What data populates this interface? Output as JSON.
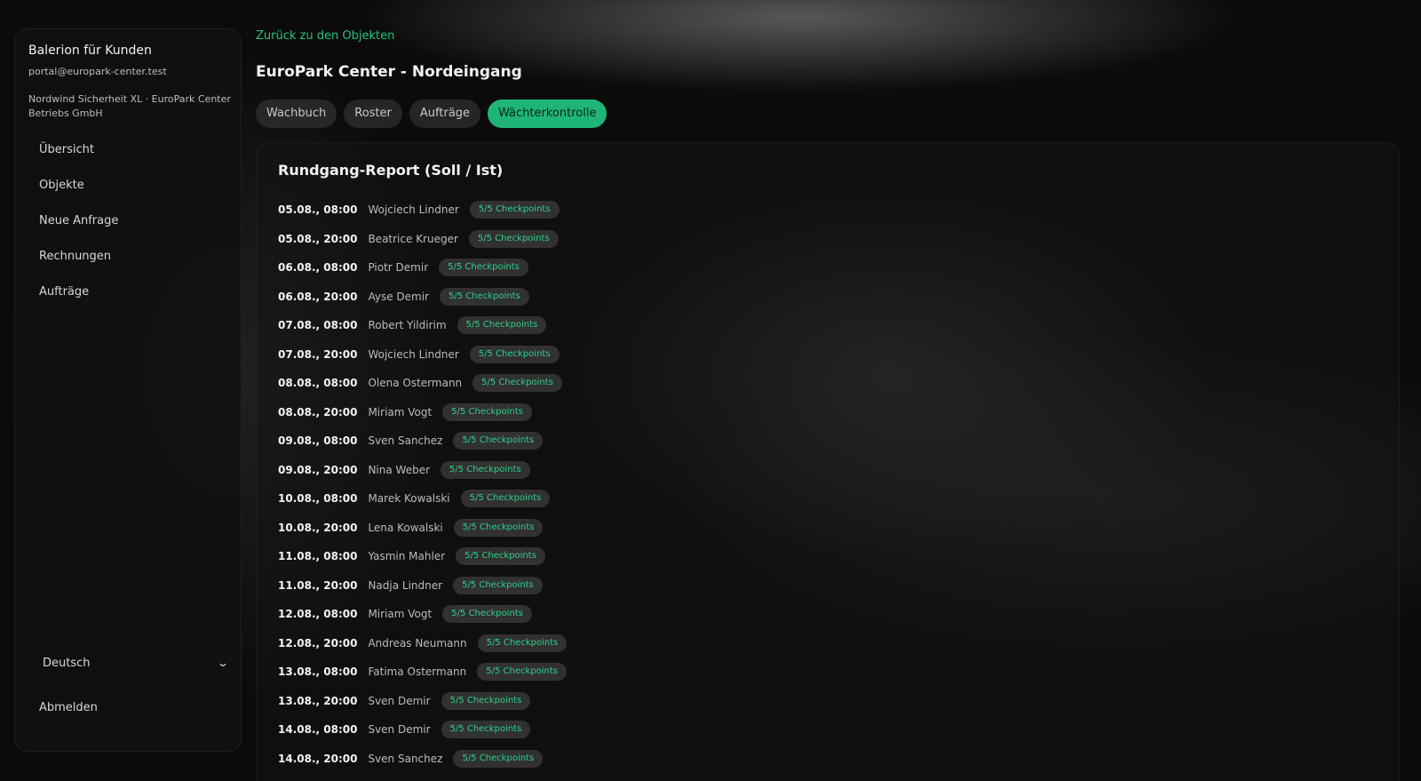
{
  "sidebar": {
    "brand": "Balerion für Kunden",
    "email": "portal@europark-center.test",
    "org": "Nordwind Sicherheit XL · EuroPark Center Betriebs GmbH",
    "nav": [
      {
        "label": "Übersicht"
      },
      {
        "label": "Objekte"
      },
      {
        "label": "Neue Anfrage"
      },
      {
        "label": "Rechnungen"
      },
      {
        "label": "Aufträge"
      }
    ],
    "language": "Deutsch",
    "logout": "Abmelden"
  },
  "header": {
    "back_link": "Zurück zu den Objekten",
    "title": "EuroPark Center - Nordeingang"
  },
  "tabs": [
    {
      "label": "Wachbuch",
      "active": false
    },
    {
      "label": "Roster",
      "active": false
    },
    {
      "label": "Aufträge",
      "active": false
    },
    {
      "label": "Wächterkontrolle",
      "active": true
    }
  ],
  "report": {
    "title": "Rundgang-Report (Soll / Ist)",
    "rows": [
      {
        "date": "05.08., 08:00",
        "name": "Wojciech Lindner",
        "status": "5/5 Checkpoints"
      },
      {
        "date": "05.08., 20:00",
        "name": "Beatrice Krueger",
        "status": "5/5 Checkpoints"
      },
      {
        "date": "06.08., 08:00",
        "name": "Piotr Demir",
        "status": "5/5 Checkpoints"
      },
      {
        "date": "06.08., 20:00",
        "name": "Ayse Demir",
        "status": "5/5 Checkpoints"
      },
      {
        "date": "07.08., 08:00",
        "name": "Robert Yildirim",
        "status": "5/5 Checkpoints"
      },
      {
        "date": "07.08., 20:00",
        "name": "Wojciech Lindner",
        "status": "5/5 Checkpoints"
      },
      {
        "date": "08.08., 08:00",
        "name": "Olena Ostermann",
        "status": "5/5 Checkpoints"
      },
      {
        "date": "08.08., 20:00",
        "name": "Miriam Vogt",
        "status": "5/5 Checkpoints"
      },
      {
        "date": "09.08., 08:00",
        "name": "Sven Sanchez",
        "status": "5/5 Checkpoints"
      },
      {
        "date": "09.08., 20:00",
        "name": "Nina Weber",
        "status": "5/5 Checkpoints"
      },
      {
        "date": "10.08., 08:00",
        "name": "Marek Kowalski",
        "status": "5/5 Checkpoints"
      },
      {
        "date": "10.08., 20:00",
        "name": "Lena Kowalski",
        "status": "5/5 Checkpoints"
      },
      {
        "date": "11.08., 08:00",
        "name": "Yasmin Mahler",
        "status": "5/5 Checkpoints"
      },
      {
        "date": "11.08., 20:00",
        "name": "Nadja Lindner",
        "status": "5/5 Checkpoints"
      },
      {
        "date": "12.08., 08:00",
        "name": "Miriam Vogt",
        "status": "5/5 Checkpoints"
      },
      {
        "date": "12.08., 20:00",
        "name": "Andreas Neumann",
        "status": "5/5 Checkpoints"
      },
      {
        "date": "13.08., 08:00",
        "name": "Fatima Ostermann",
        "status": "5/5 Checkpoints"
      },
      {
        "date": "13.08., 20:00",
        "name": "Sven Demir",
        "status": "5/5 Checkpoints"
      },
      {
        "date": "14.08., 08:00",
        "name": "Sven Demir",
        "status": "5/5 Checkpoints"
      },
      {
        "date": "14.08., 20:00",
        "name": "Sven Sanchez",
        "status": "5/5 Checkpoints"
      }
    ]
  },
  "colors": {
    "accent": "#1fb576",
    "accent_text": "#25c47f",
    "background": "#0b0b0b"
  }
}
